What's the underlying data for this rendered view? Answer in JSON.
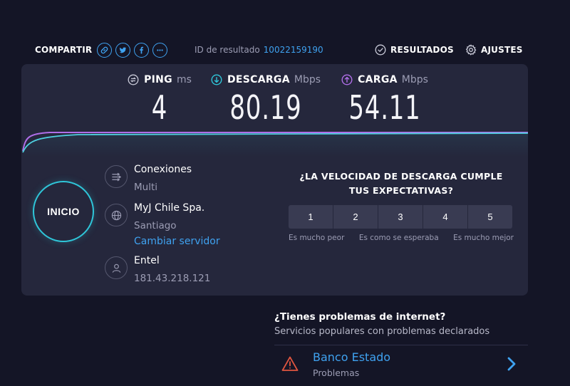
{
  "topbar": {
    "share_label": "COMPARTIR",
    "share_icons": [
      "link-icon",
      "twitter-icon",
      "facebook-icon",
      "more-icon"
    ],
    "result_id_label": "ID de resultado",
    "result_id_value": "10022159190",
    "results_label": "RESULTADOS",
    "settings_label": "AJUSTES"
  },
  "metrics": {
    "ping": {
      "name": "PING",
      "unit": "ms",
      "value": "4"
    },
    "download": {
      "name": "DESCARGA",
      "unit": "Mbps",
      "value": "80.19"
    },
    "upload": {
      "name": "CARGA",
      "unit": "Mbps",
      "value": "54.11"
    }
  },
  "start_button": {
    "label": "INICIO"
  },
  "connection": {
    "connections_label": "Conexiones",
    "connections_value": "Multi",
    "server_name": "MyJ Chile Spa.",
    "server_city": "Santiago",
    "change_server_label": "Cambiar servidor",
    "isp_name": "Entel",
    "isp_ip": "181.43.218.121"
  },
  "survey": {
    "question": "¿LA VELOCIDAD DE DESCARGA CUMPLE TUS EXPECTATIVAS?",
    "options": [
      "1",
      "2",
      "3",
      "4",
      "5"
    ],
    "low_label": "Es mucho peor",
    "mid_label": "Es como se esperaba",
    "high_label": "Es mucho mejor"
  },
  "problems": {
    "title": "¿Tienes problemas de internet?",
    "subtitle": "Servicios populares con problemas declarados",
    "items": [
      {
        "name": "Banco Estado",
        "status": "Problemas"
      }
    ]
  },
  "colors": {
    "background": "#141526",
    "panel": "#25273c",
    "accent_blue": "#3fa2f0",
    "download_cyan": "#2fc6d9",
    "upload_purple": "#b06ee8",
    "warning_red": "#e0553f"
  }
}
